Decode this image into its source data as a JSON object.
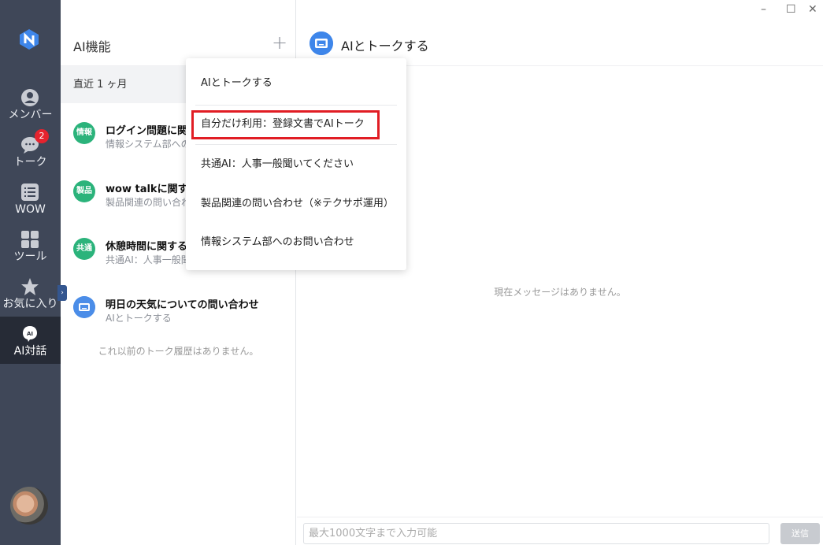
{
  "window": {
    "minimize": "–",
    "maximize": "☐",
    "close": "✕"
  },
  "rail": {
    "items": [
      {
        "label": "メンバー",
        "icon": "member-icon"
      },
      {
        "label": "トーク",
        "icon": "chat-bubble-icon",
        "badge": "2"
      },
      {
        "label": "WOW",
        "icon": "wow-list-icon"
      },
      {
        "label": "ツール",
        "icon": "grid-tools-icon"
      },
      {
        "label": "お気に入り",
        "icon": "star-icon"
      },
      {
        "label": "AI対話",
        "icon": "ai-chat-icon"
      }
    ],
    "ai_icon_text": "AI",
    "collapse_glyph": "›"
  },
  "list": {
    "title": "AI機能",
    "add_glyph": "+",
    "period": "直近 1 ヶ月",
    "conversations": [
      {
        "icon_text": "情報",
        "title": "ログイン問題に関す",
        "subtitle": "情報システム部への"
      },
      {
        "icon_text": "製品",
        "title": "wow talkに関する",
        "subtitle": "製品関連の問い合わ"
      },
      {
        "icon_text": "共通",
        "title": "休憩時間に関する質",
        "subtitle": "共通AI：人事一般聞"
      },
      {
        "icon_text": "",
        "title": "明日の天気についての問い合わせ",
        "subtitle": "AIとトークする"
      }
    ],
    "no_history": "これ以前のトーク履歴はありません。"
  },
  "main": {
    "title": "AIとトークする",
    "empty": "現在メッセージはありません。",
    "input_placeholder": "最大1000文字まで入力可能",
    "send_label": "送信"
  },
  "menu": {
    "items": [
      "AIとトークする",
      "自分だけ利用：登録文書でAIトーク",
      "共通AI：人事一般聞いてください",
      "製品関連の問い合わせ（※テクサポ運用）",
      "情報システム部へのお問い合わせ"
    ]
  },
  "colors": {
    "rail": "#3f4758",
    "rail_active": "#262b36",
    "accent": "#3e86ea",
    "green": "#2bb37b",
    "highlight": "#e11d24",
    "badge": "#e5232e"
  }
}
